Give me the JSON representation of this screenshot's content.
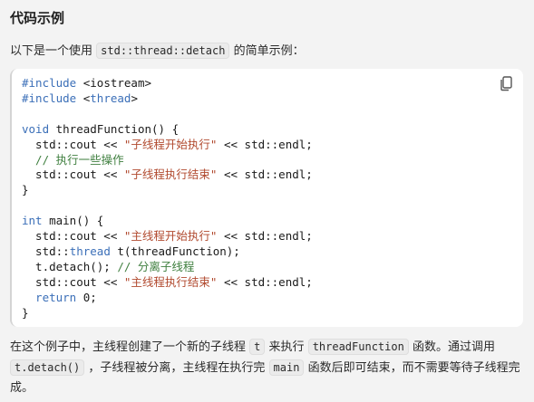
{
  "section": {
    "title": "代码示例"
  },
  "intro": {
    "before": "以下是一个使用",
    "code": "std::thread::detach",
    "after": "的简单示例："
  },
  "code_block": {
    "copy_icon": "copy-icon",
    "line1_kw": "#include",
    "line1_rest": " <iostream>",
    "line2_kw": "#include",
    "line2_rest": " <",
    "line2_kw2": "thread",
    "line2_end": ">",
    "line4_kw": "void",
    "line4_rest": " threadFunction() {",
    "line5_pre": "  std::cout << ",
    "line5_str": "\"子线程开始执行\"",
    "line5_post": " << std::endl;",
    "line6_cm": "  // 执行一些操作",
    "line7_pre": "  std::cout << ",
    "line7_str": "\"子线程执行结束\"",
    "line7_post": " << std::endl;",
    "line8": "}",
    "line10_kw": "int",
    "line10_rest": " main() {",
    "line11_pre": "  std::cout << ",
    "line11_str": "\"主线程开始执行\"",
    "line11_post": " << std::endl;",
    "line12_pre": "  std::",
    "line12_kw": "thread",
    "line12_post": " t(threadFunction);",
    "line13_pre": "  t.detach(); ",
    "line13_cm": "// 分离子线程",
    "line14_pre": "  std::cout << ",
    "line14_str": "\"主线程执行结束\"",
    "line14_post": " << std::endl;",
    "line15_kw": "  return",
    "line15_rest": " 0;",
    "line16": "}"
  },
  "outro": {
    "p1_a": "在这个例子中，主线程创建了一个新的子线程",
    "p1_code1": "t",
    "p1_b": "来执行",
    "p1_code2": "threadFunction",
    "p1_c": "函数。通过调用",
    "p1_code3": "t.detach()",
    "p1_d": "，子线程被分离，主线程在执行完",
    "p1_code4": "main",
    "p1_e": "函数后即可结束，而不需要等待子线程完成。"
  }
}
